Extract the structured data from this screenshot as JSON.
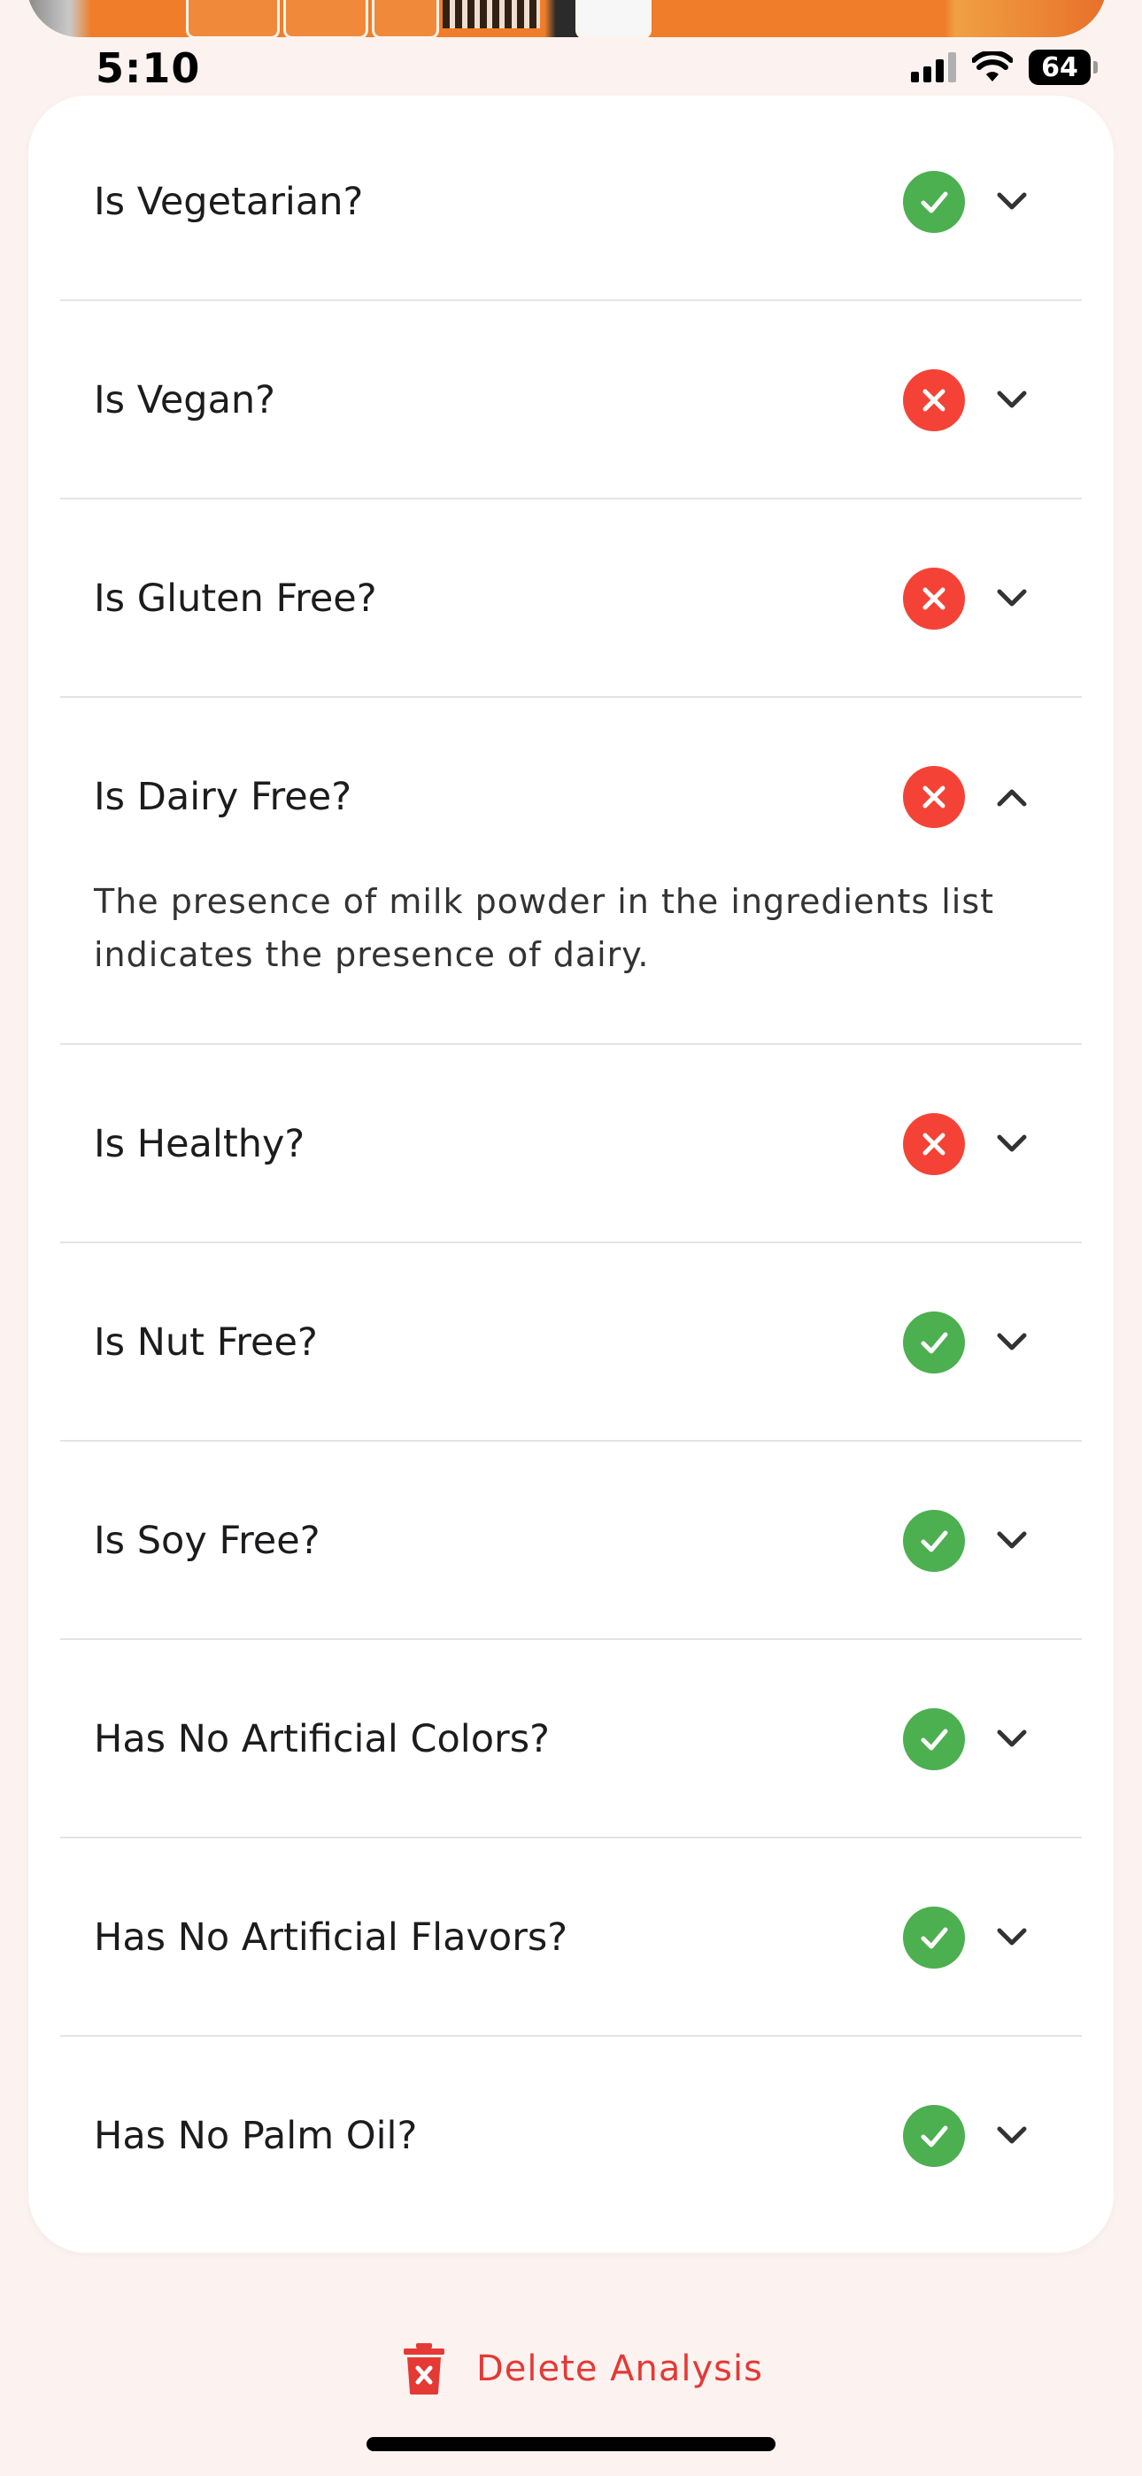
{
  "status_bar": {
    "time": "5:10",
    "battery": "64"
  },
  "checks": [
    {
      "label": "Is Vegetarian?",
      "result": "pass",
      "icon": "check-icon",
      "expanded": false
    },
    {
      "label": "Is Vegan?",
      "result": "fail",
      "icon": "x-icon",
      "expanded": false
    },
    {
      "label": "Is Gluten Free?",
      "result": "fail",
      "icon": "x-icon",
      "expanded": false
    },
    {
      "label": "Is Dairy Free?",
      "result": "fail",
      "icon": "x-icon",
      "expanded": true,
      "detail": "The presence of milk powder in the ingredients list indicates the presence of dairy."
    },
    {
      "label": "Is Healthy?",
      "result": "fail",
      "icon": "x-icon",
      "expanded": false
    },
    {
      "label": "Is Nut Free?",
      "result": "pass",
      "icon": "check-icon",
      "expanded": false
    },
    {
      "label": "Is Soy Free?",
      "result": "pass",
      "icon": "check-icon",
      "expanded": false
    },
    {
      "label": "Has No Artificial Colors?",
      "result": "pass",
      "icon": "check-icon",
      "expanded": false
    },
    {
      "label": "Has No Artificial Flavors?",
      "result": "pass",
      "icon": "check-icon",
      "expanded": false
    },
    {
      "label": "Has No Palm Oil?",
      "result": "pass",
      "icon": "check-icon",
      "expanded": false
    }
  ],
  "actions": {
    "delete_label": "Delete Analysis",
    "delete_icon": "trash-x-icon"
  },
  "colors": {
    "pass": "#4caf50",
    "fail": "#f44336",
    "danger_text": "#e53935",
    "background": "#fcf3f1",
    "card": "#ffffff"
  }
}
